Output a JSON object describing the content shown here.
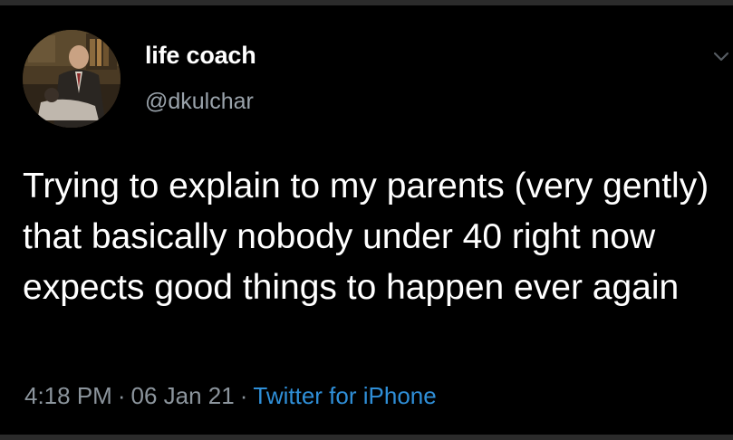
{
  "tweet": {
    "display_name": "life coach",
    "handle": "@dkulchar",
    "text": "Trying to explain to my parents (very gently) that basically nobody under 40 right now expects good things to happen ever again",
    "time": "4:18 PM",
    "date": "06 Jan 21",
    "separator": "·",
    "source": "Twitter for iPhone",
    "avatar_icon": "profile-photo",
    "more_icon": "chevron-down-icon"
  },
  "colors": {
    "background": "#000000",
    "text": "#ffffff",
    "secondary_text": "#8c959d",
    "link": "#2f8fd8"
  }
}
